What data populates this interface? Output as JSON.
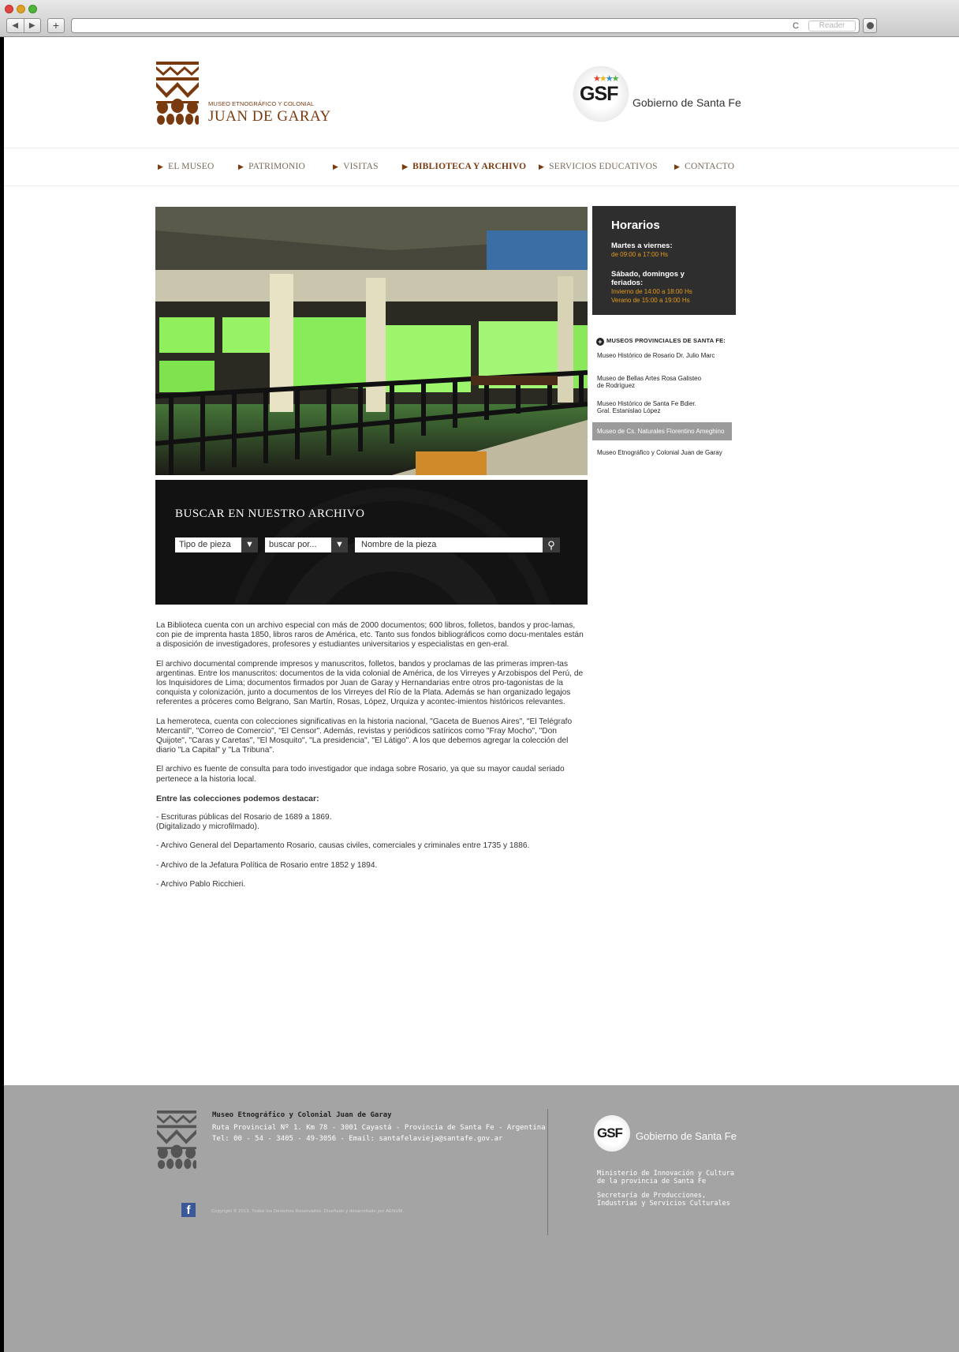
{
  "browser": {
    "reader_label": "Reader",
    "back_glyph": "◀",
    "forward_glyph": "▶",
    "new_tab_glyph": "+",
    "reload_glyph": "C"
  },
  "header": {
    "logo_small": "MUSEO ETNOGRÁFICO Y COLONIAL",
    "logo_big": "JUAN DE GARAY",
    "gsf_letters": "GSF",
    "gov_name": "Gobierno de Santa Fe"
  },
  "menu": {
    "items": [
      {
        "label": "EL MUSEO"
      },
      {
        "label": "PATRIMONIO"
      },
      {
        "label": "VISITAS"
      },
      {
        "label": "BIBLIOTECA Y ARCHIVO"
      },
      {
        "label": "SERVICIOS EDUCATIVOS"
      },
      {
        "label": "CONTACTO"
      }
    ],
    "active_index": 3
  },
  "horarios": {
    "title": "Horarios",
    "weekday_label": "Martes a viernes:",
    "weekday_hours": "de 09:00 a 17:00 Hs",
    "weekend_label": "Sábado, domingos y feriados:",
    "winter_hours": "Invierno de 14:00 a 18:00 Hs",
    "summer_hours": "Verano de 15:00 a 19:00 Hs"
  },
  "sidebar": {
    "title": "MUSEOS PROVINCIALES DE SANTA FE:",
    "items": [
      {
        "label_1": "Museo Histórico de Rosario Dr. Julio Marc",
        "label_2": ""
      },
      {
        "label_1": "Museo de Bellas Artes Rosa Galisteo",
        "label_2": "de Rodríguez"
      },
      {
        "label_1": "Museo Histórico de Santa Fe Bdier.",
        "label_2": "Gral. Estanislao López"
      },
      {
        "label_1": "Museo de Cs. Naturales Florentino Ameghino",
        "label_2": ""
      },
      {
        "label_1": "Museo Etnográfico y Colonial Juan de Garay",
        "label_2": ""
      }
    ],
    "highlighted_index": 3
  },
  "search": {
    "title": "BUSCAR EN NUESTRO ARCHIVO",
    "type_select": "Tipo de pieza",
    "by_select": "buscar por...",
    "name_input": "Nombre de la pieza",
    "arrow_glyph": "▼",
    "search_icon_glyph": "⚲"
  },
  "content": {
    "p1": "La Biblioteca cuenta con un archivo especial con más de 2000 documentos; 600 libros, folletos, bandos y proc-lamas, con pie de imprenta hasta 1850, libros raros de América, etc. Tanto sus fondos bibliográficos como docu-mentales están a disposición de investigadores, profesores y estudiantes universitarios y especialistas en gen-eral.",
    "p2": "El archivo documental comprende impresos y manuscritos, folletos, bandos y proclamas de las primeras impren-tas argentinas. Entre los manuscritos: documentos de la vida colonial de América, de los Virreyes y Arzobispos del Perú, de los Inquisidores de Lima; documentos firmados por Juan de Garay y Hernandarias entre otros pro-tagonistas de la conquista y colonización, junto a documentos de los Virreyes del Río de la Plata. Además se han organizado legajos referentes a próceres como Belgrano, San Martín, Rosas, López, Urquiza y acontec-imientos históricos relevantes.",
    "p3": "La hemeroteca, cuenta con colecciones significativas en la historia nacional, \"Gaceta de Buenos Aires\", \"El Telégrafo Mercantil\", \"Correo de Comercio\", \"El Censor\". Además, revistas y periódicos satíricos como \"Fray Mocho\", \"Don Quijote\", \"Caras y Caretas\", \"El Mosquito\", \"La presidencia\", \"El Látigo\". A los que debemos agregar la colección del diario \"La Capital\" y \"La Tribuna\".",
    "p4": "El archivo es fuente de consulta para todo investigador que indaga sobre Rosario, ya que su mayor caudal seriado pertenece a la historia local.",
    "heading": "Entre las colecciones podemos destacar:",
    "list1a": "- Escrituras públicas del Rosario de 1689 a 1869.",
    "list1b": "(Digitalizado y microfilmado).",
    "list2": "- Archivo General del Departamento Rosario, causas civiles, comerciales y criminales entre 1735 y 1886.",
    "list3": "- Archivo de la Jefatura Política de Rosario entre 1852 y 1894.",
    "list4": "- Archivo Pablo Ricchieri."
  },
  "footer": {
    "name": "Museo Etnográfico y Colonial Juan de Garay",
    "address": "Ruta Provincial Nº 1. Km 78 - 3001 Cayastá - Provincia de Santa Fe - Argentina",
    "contact": "Tel: 00 - 54 - 3405 - 49-3056 - Email: santafelavieja@santafe.gov.ar",
    "gsf_letters": "GSF",
    "gov_name": "Gobierno de Santa Fe",
    "ministry_1": "Ministerio de Innovación y Cultura",
    "ministry_2": "de la provincia de Santa Fe",
    "secretary_1": "Secretaría de Producciones,",
    "secretary_2": "Industrias y Servicios Culturales",
    "facebook_glyph": "f",
    "copyright": "Copyright © 2013. Todos los Derechos Reservados. Diseñado y desarrollado por AENUM."
  },
  "colors": {
    "brand_brown": "#7a3a0f",
    "hours_orange": "#e59a1a",
    "footer_gray": "#a4a4a4",
    "facebook_blue": "#3b5998"
  }
}
